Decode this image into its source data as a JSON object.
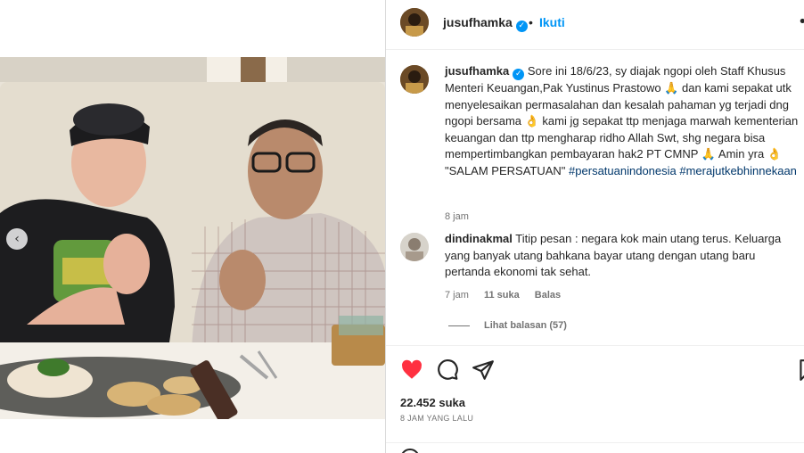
{
  "post": {
    "username": "jusufhamka",
    "verified_mark": "✓",
    "dot": "•",
    "follow_label": "Ikuti",
    "more_icon": "more-icon"
  },
  "caption": {
    "username": "jusufhamka",
    "text": "Sore ini 18/6/23, sy diajak ngopi oleh Staff Khusus Menteri Keuangan,Pak Yustinus Prastowo 🙏 dan kami sepakat utk menyelesaikan permasalahan dan kesalah pahaman yg terjadi dng ngopi bersama 👌 kami jg sepakat ttp menjaga marwah kementerian keuangan dan ttp mengharap ridho Allah Swt, shg negara bisa mempertimbangkan pembayaran hak2 PT CMNP 🙏  Amin yra 👌  \"SALAM PERSATUAN\"",
    "hashtags": "#persatuanindonesia #merajutkebhinnekaan",
    "time": "8 jam"
  },
  "comment": {
    "username": "dindinakmal",
    "text": "Titip pesan : negara kok main utang terus. Keluarga yang banyak utang bahkana bayar utang dengan utang baru pertanda ekonomi tak sehat.",
    "time": "7 jam",
    "likes": "11 suka",
    "reply_label": "Balas",
    "view_replies": "Lihat balasan (57)"
  },
  "actions": {
    "likes": "22.452 suka",
    "time_ago": "8 JAM YANG LALU",
    "heart_color": "#ff3040"
  },
  "carousel": {
    "prev_icon": "‹"
  }
}
